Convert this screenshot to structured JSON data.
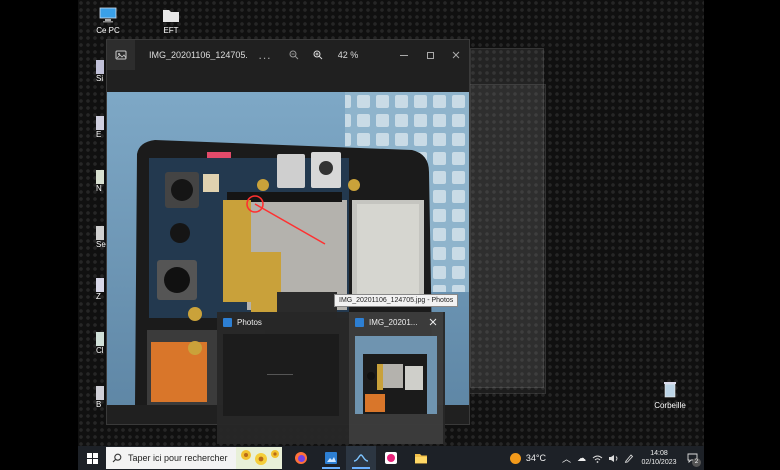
{
  "desktop": {
    "icons": [
      {
        "label": "Ce PC"
      },
      {
        "label": "EFT"
      },
      {
        "label": "Corbeille"
      }
    ],
    "partial_labels": [
      "Si",
      "E",
      "N",
      "Se",
      "Z",
      "Cl",
      "B"
    ]
  },
  "photos_window": {
    "title": "IMG_20201106_124705.j...",
    "more_label": "...",
    "zoom_level": "42 %",
    "tooltip": "IMG_20201106_124705.jpg - Photos"
  },
  "thumbnails": {
    "items": [
      {
        "label": "Photos"
      },
      {
        "label": "IMG_20201..."
      }
    ]
  },
  "taskbar": {
    "search_placeholder": "Taper ici pour rechercher",
    "weather_temp": "34°C",
    "time": "14:08",
    "date": "02/10/2023",
    "notification_count": "2"
  },
  "colors": {
    "taskbar_bg": "#1d2127",
    "accent": "#6ab0ff",
    "window_bg": "#202020"
  }
}
